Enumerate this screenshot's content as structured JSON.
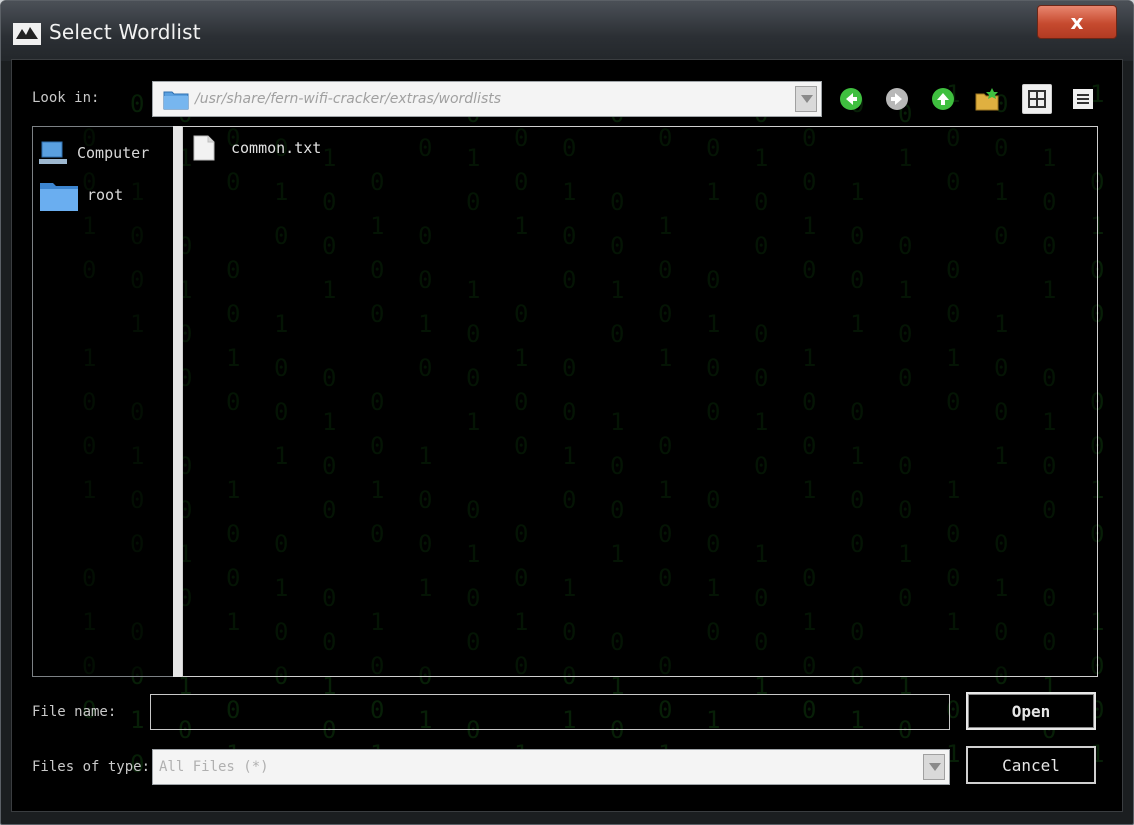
{
  "window": {
    "title": "Select Wordlist",
    "close_glyph": "x"
  },
  "toolbar": {
    "look_in_label": "Look in:",
    "path": "/usr/share/fern-wifi-cracker/extras/wordlists",
    "buttons": [
      "back-icon",
      "forward-icon",
      "up-icon",
      "new-folder-icon",
      "icon-view-icon",
      "detail-view-icon"
    ]
  },
  "sidebar": {
    "items": [
      {
        "label": "Computer",
        "icon": "computer-icon"
      },
      {
        "label": "root",
        "icon": "folder-icon"
      }
    ]
  },
  "files": [
    {
      "name": "common.txt",
      "icon": "file-icon"
    }
  ],
  "footer": {
    "file_name_label": "File name:",
    "file_name_value": "",
    "files_of_type_label": "Files of type:",
    "files_of_type_value": "All Files (*)",
    "open_label": "Open",
    "cancel_label": "Cancel"
  },
  "colors": {
    "accent_green": "#3fbf3f",
    "matrix_green": "#145a14",
    "close_red": "#c64a2f"
  }
}
